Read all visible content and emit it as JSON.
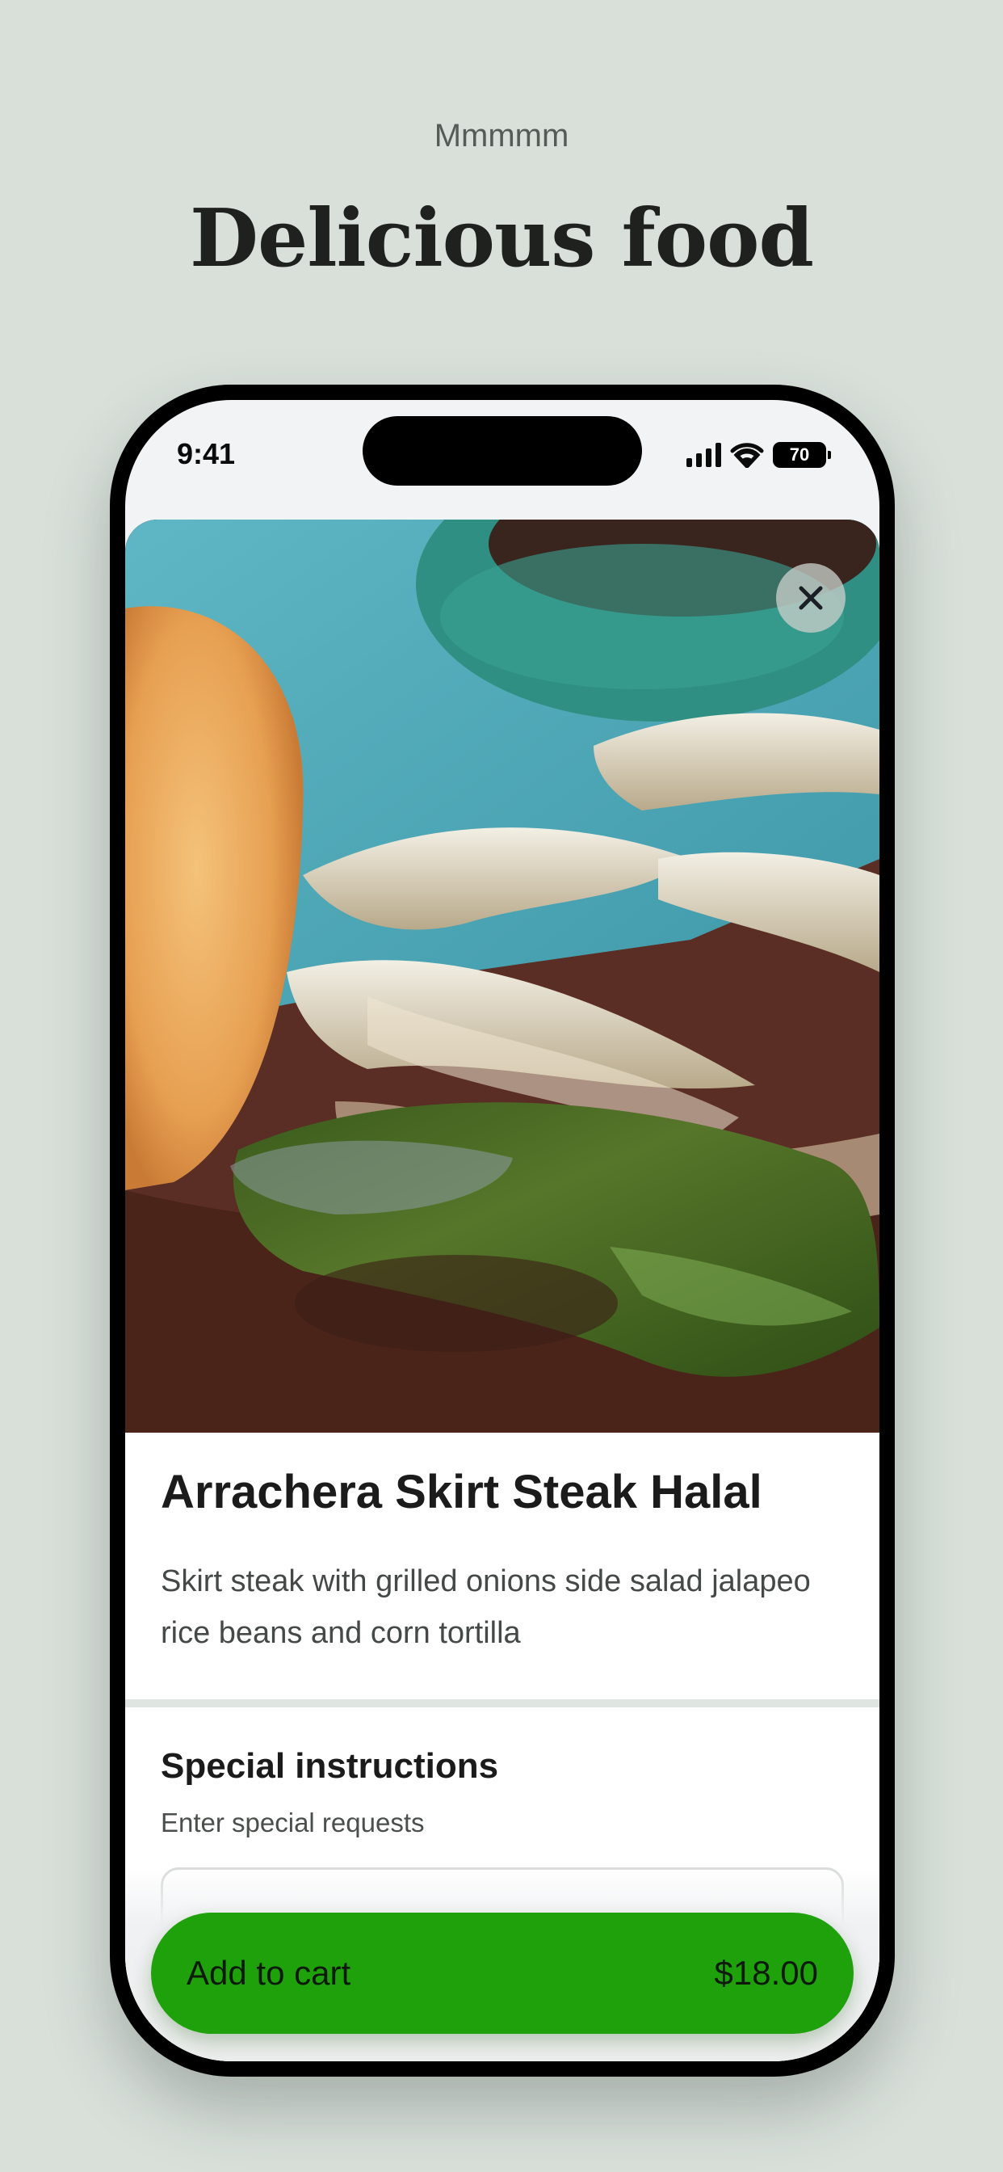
{
  "page": {
    "kicker": "Mmmmm",
    "headline": "Delicious food"
  },
  "status_bar": {
    "time": "9:41",
    "battery": "70"
  },
  "item": {
    "title": "Arrachera Skirt Steak Halal",
    "description": "Skirt steak with grilled onions side salad jalapeo rice beans and corn tortilla"
  },
  "special_instructions": {
    "title": "Special instructions",
    "subtitle": "Enter special requests",
    "value": ""
  },
  "cart": {
    "label": "Add to cart",
    "price": "$18.00"
  },
  "colors": {
    "background": "#d9e0da",
    "accent": "#1ea10a"
  },
  "icons": {
    "close": "close-icon",
    "signal": "cellular-signal-icon",
    "wifi": "wifi-icon",
    "battery": "battery-icon"
  }
}
